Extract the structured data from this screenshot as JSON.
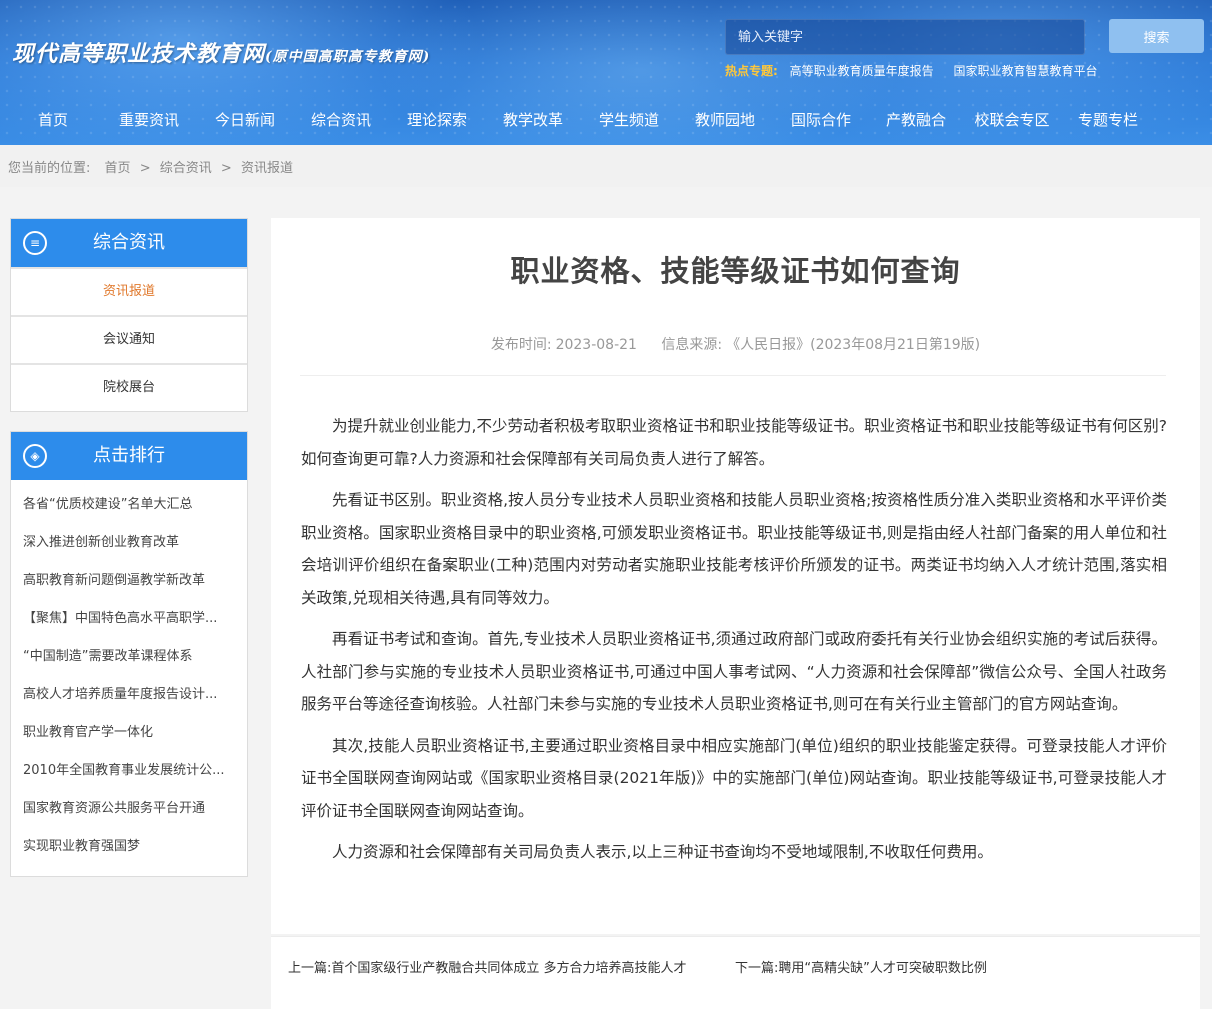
{
  "site": {
    "logo_main": "现代高等职业技术教育网",
    "logo_sub": "(原中国高职高专教育网)"
  },
  "search": {
    "placeholder": "输入关键字",
    "button_label": "搜索"
  },
  "hot_topics": {
    "label": "热点专题:",
    "links": [
      "高等职业教育质量年度报告",
      "国家职业教育智慧教育平台"
    ]
  },
  "nav": {
    "items": [
      "首页",
      "重要资讯",
      "今日新闻",
      "综合资讯",
      "理论探索",
      "教学改革",
      "学生频道",
      "教师园地",
      "国际合作",
      "产教融合",
      "校联会专区",
      "专题专栏"
    ]
  },
  "breadcrumb": {
    "prefix": "您当前的位置:",
    "items": [
      "首页",
      "综合资讯",
      "资讯报道"
    ],
    "separator": ">"
  },
  "sidebar": {
    "category": {
      "title": "综合资讯",
      "items": [
        "资讯报道",
        "会议通知",
        "院校展台"
      ],
      "active_index": 0
    },
    "ranking": {
      "title": "点击排行",
      "items": [
        "各省“优质校建设”名单大汇总",
        "深入推进创新创业教育改革",
        "高职教育新问题倒逼教学新改革",
        "【聚焦】中国特色高水平高职学...",
        "“中国制造”需要改革课程体系",
        "高校人才培养质量年度报告设计...",
        "职业教育官产学一体化",
        "2010年全国教育事业发展统计公...",
        "国家教育资源公共服务平台开通",
        "实现职业教育强国梦"
      ]
    }
  },
  "article": {
    "title": "职业资格、技能等级证书如何查询",
    "publish_label": "发布时间:",
    "publish_date": "2023-08-21",
    "source_label": "信息来源:",
    "source": "《人民日报》(2023年08月21日第19版)",
    "paragraphs": [
      "为提升就业创业能力,不少劳动者积极考取职业资格证书和职业技能等级证书。职业资格证书和职业技能等级证书有何区别?如何查询更可靠?人力资源和社会保障部有关司局负责人进行了解答。",
      "先看证书区别。职业资格,按人员分专业技术人员职业资格和技能人员职业资格;按资格性质分准入类职业资格和水平评价类职业资格。国家职业资格目录中的职业资格,可颁发职业资格证书。职业技能等级证书,则是指由经人社部门备案的用人单位和社会培训评价组织在备案职业(工种)范围内对劳动者实施职业技能考核评价所颁发的证书。两类证书均纳入人才统计范围,落实相关政策,兑现相关待遇,具有同等效力。",
      "再看证书考试和查询。首先,专业技术人员职业资格证书,须通过政府部门或政府委托有关行业协会组织实施的考试后获得。人社部门参与实施的专业技术人员职业资格证书,可通过中国人事考试网、“人力资源和社会保障部”微信公众号、全国人社政务服务平台等途径查询核验。人社部门未参与实施的专业技术人员职业资格证书,则可在有关行业主管部门的官方网站查询。",
      "其次,技能人员职业资格证书,主要通过职业资格目录中相应实施部门(单位)组织的职业技能鉴定获得。可登录技能人才评价证书全国联网查询网站或《国家职业资格目录(2021年版)》中的实施部门(单位)网站查询。职业技能等级证书,可登录技能人才评价证书全国联网查询网站查询。",
      "人力资源和社会保障部有关司局负责人表示,以上三种证书查询均不受地域限制,不收取任何费用。"
    ]
  },
  "pager": {
    "prev_label": "上一篇:",
    "prev_title": "首个国家级行业产教融合共同体成立 多方合力培养高技能人才",
    "next_label": "下一篇:",
    "next_title": "聘用“高精尖缺”人才可突破职数比例"
  },
  "colors": {
    "accent": "#2d8ceb",
    "active": "#e0782b",
    "hot_label": "#ffc83a"
  }
}
